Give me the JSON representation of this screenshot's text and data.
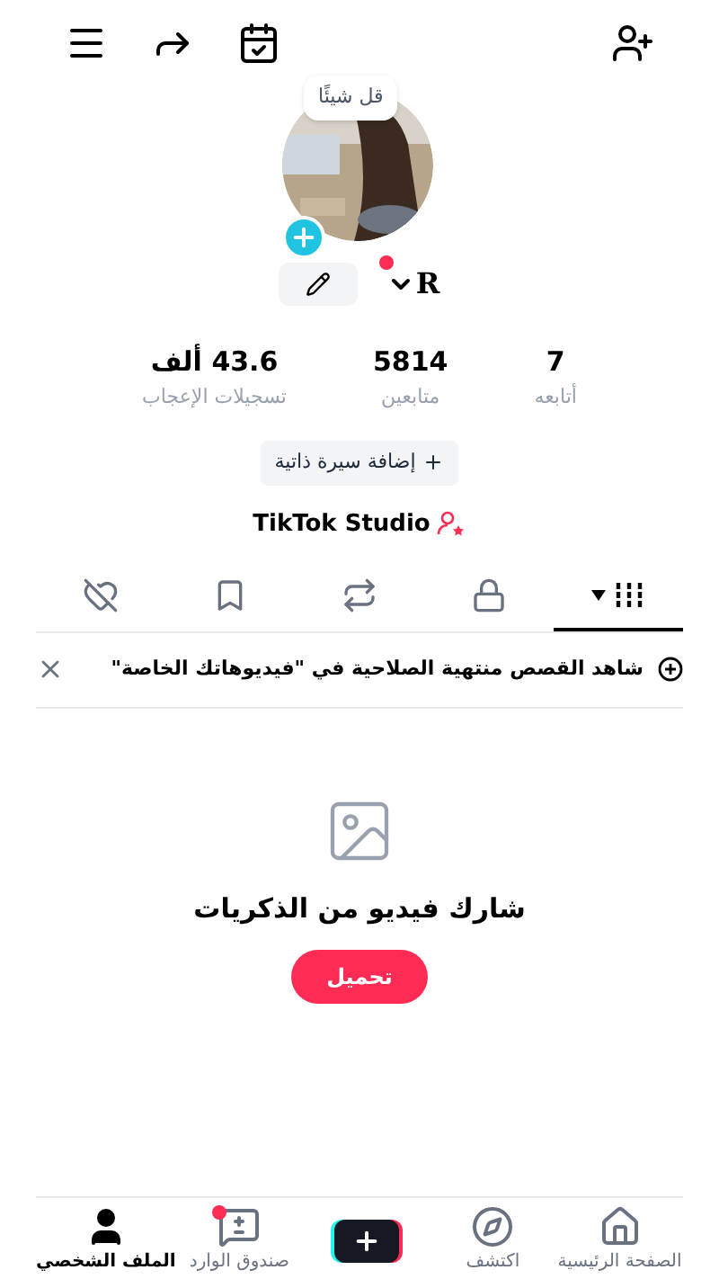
{
  "speech_bubble": "قل شيئًا",
  "username": "R",
  "stats": [
    {
      "value": "7",
      "label": "أتابعه"
    },
    {
      "value": "5814",
      "label": "متابعين"
    },
    {
      "value": "43.6 ألف",
      "label": "تسجيلات الإعجاب"
    }
  ],
  "bio_button": "إضافة سيرة ذاتية",
  "studio_link": "TikTok Studio",
  "content_tabs": [
    {
      "kind": "grid",
      "selected": true
    },
    {
      "kind": "lock",
      "selected": false
    },
    {
      "kind": "repost",
      "selected": false
    },
    {
      "kind": "bookmark",
      "selected": false
    },
    {
      "kind": "liked",
      "selected": false
    }
  ],
  "banner": {
    "text": "شاهد القصص منتهية الصلاحية في \"فيديوهاتك الخاصة\""
  },
  "empty_state": {
    "title": "شارك فيديو من الذكريات",
    "button": "تحميل"
  },
  "bottom_nav": [
    {
      "kind": "home",
      "label": "الصفحة الرئيسية",
      "selected": false,
      "badge": false
    },
    {
      "kind": "discover",
      "label": "اكتشف",
      "selected": false,
      "badge": false
    },
    {
      "kind": "create",
      "badge": false
    },
    {
      "kind": "inbox",
      "label": "صندوق الوارد",
      "selected": false,
      "badge": true
    },
    {
      "kind": "profile",
      "label": "الملف الشخصي",
      "selected": true,
      "badge": false
    }
  ]
}
